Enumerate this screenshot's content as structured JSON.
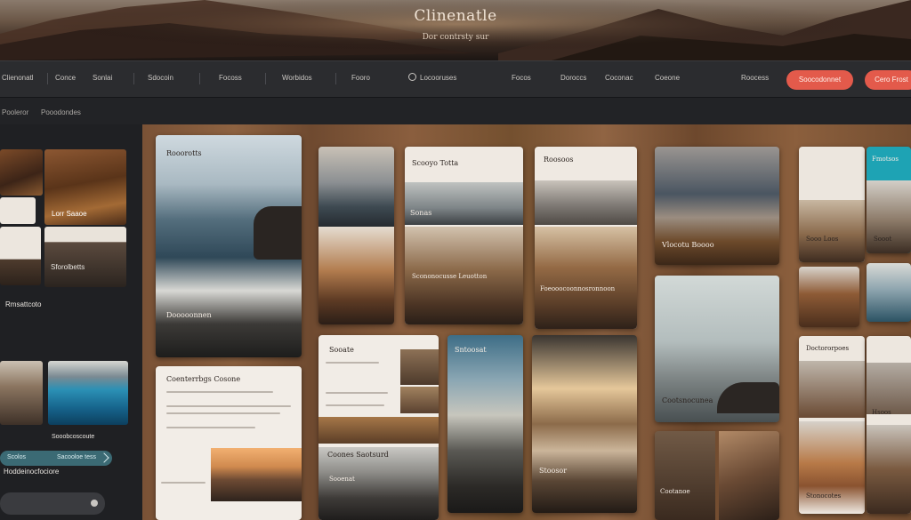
{
  "hero": {
    "brand": "Clinenatle",
    "tagline": "Dor contrsty sur"
  },
  "nav": {
    "items": [
      "Clienonatl",
      "Conce",
      "Sonlai",
      "Sdocoin",
      "Focoss",
      "Worbidos",
      "Fooro",
      "Locooruses",
      "Focos",
      "Doroccs",
      "Coconac",
      "Coeone",
      "Roocess"
    ],
    "buttons": [
      "Soocodonnet",
      "Cero Frost"
    ]
  },
  "subbar": {
    "crumbs": [
      "Pooleror",
      "Pooodondes"
    ]
  },
  "sidebar": {
    "card_label_1": "Lorr Saaoe",
    "card_label_2": "Sforolbetts",
    "section_heading": "Rmsattcoto",
    "pill_left": "Scolos",
    "pill_right": "Sacooloe tess",
    "caption": "Sooobcoscoute",
    "bottom_heading": "Hoddeinocfociore"
  },
  "gallery": {
    "cards": [
      {
        "title": "Rooorotts",
        "caption": "Dooooonnen"
      },
      {
        "title": "Coenterrbgs Cosone"
      },
      {
        "title": "Scooyo Totta",
        "caption": "Sonas"
      },
      {
        "title": "Scononocusse Leuotton"
      },
      {
        "title": "Sooate"
      },
      {
        "title": "Sntoosat"
      },
      {
        "title": "Coones Saotsurd",
        "caption": "Sooenat"
      },
      {
        "title": "Roosoos"
      },
      {
        "title": "Foeooocoonnosronnoon"
      },
      {
        "title": "Stoosor"
      },
      {
        "title": "Vlocotu Boooo"
      },
      {
        "title": "Cootsnocunea"
      },
      {
        "title": "Cootanoe"
      },
      {
        "title": "Doctororpoes"
      },
      {
        "title": "Fmotsos"
      },
      {
        "title": "Sooo Loos"
      },
      {
        "title": "Sooot"
      },
      {
        "title": "Hsoos"
      },
      {
        "title": "Stonocotes"
      }
    ]
  },
  "colors": {
    "accent": "#e35a4b",
    "teal": "#3b6a74",
    "wood": "#7a5236",
    "nav_bg": "#2b2c2f"
  }
}
